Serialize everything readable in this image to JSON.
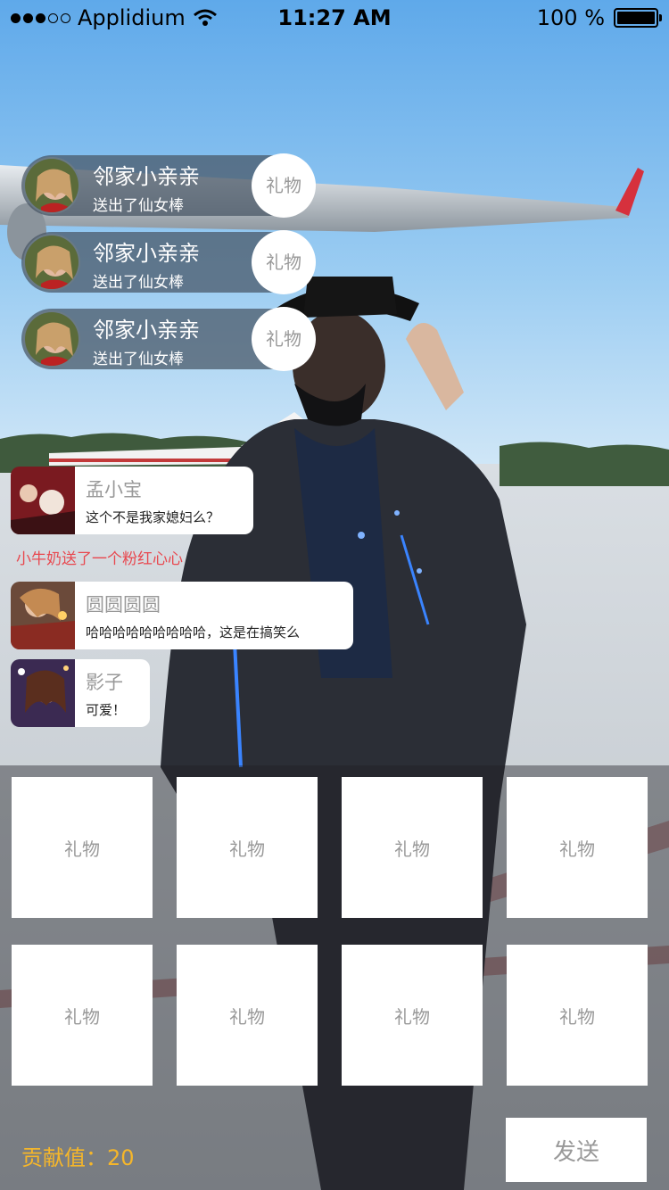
{
  "status_bar": {
    "carrier": "Applidium",
    "time": "11:27 AM",
    "battery": "100 %"
  },
  "gift_notices": [
    {
      "name": "邻家小亲亲",
      "message": "送出了仙女棒",
      "gift_label": "礼物"
    },
    {
      "name": "邻家小亲亲",
      "message": "送出了仙女棒",
      "gift_label": "礼物"
    },
    {
      "name": "邻家小亲亲",
      "message": "送出了仙女棒",
      "gift_label": "礼物"
    }
  ],
  "chat_messages": [
    {
      "name": "孟小宝",
      "text": "这个不是我家媳妇么？"
    },
    {
      "name": "圆圆圆圆",
      "text": "哈哈哈哈哈哈哈哈哈，这是在搞笑么"
    },
    {
      "name": "影子",
      "text": "可爱！"
    }
  ],
  "gift_event": "小牛奶送了一个粉红心心",
  "gift_panel": {
    "tiles": [
      "礼物",
      "礼物",
      "礼物",
      "礼物",
      "礼物",
      "礼物",
      "礼物",
      "礼物"
    ],
    "contribution_label": "贡献值：20",
    "send_label": "发送"
  },
  "colors": {
    "sky": "#6fb2e8",
    "gift_event_text": "#e8484f",
    "contribution_text": "#f5b62a",
    "notice_pill": "#46556a"
  }
}
